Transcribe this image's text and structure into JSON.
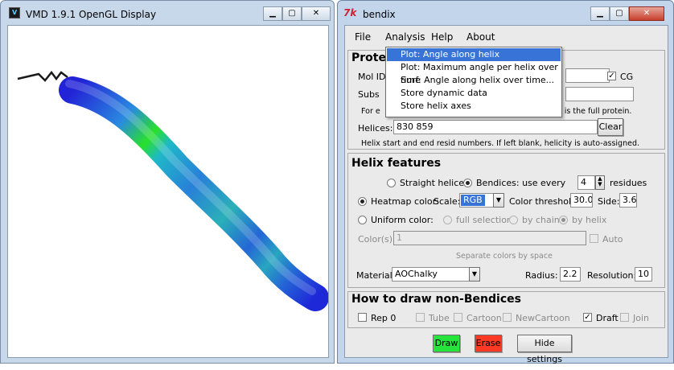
{
  "vmd": {
    "title": "VMD 1.9.1 OpenGL Display",
    "icon": "vmd-logo-icon",
    "window_buttons": [
      "minimize-icon",
      "maximize-icon",
      "close-icon"
    ]
  },
  "bendix": {
    "title": "bendix",
    "icon": "tk-feather-icon",
    "menu": {
      "file": "File",
      "analysis": "Analysis",
      "help": "Help",
      "about": "About"
    },
    "analysis_menu": [
      "Plot: Angle along helix",
      "Plot: Maximum angle per helix over time",
      "Surf: Angle along helix over time...",
      "Store dynamic data",
      "Store helix axes"
    ],
    "protein": {
      "title_visible": "Prote",
      "molid_label": "Mol ID",
      "cg_label": "CG",
      "cg_checked": true,
      "subset_label": "Subs",
      "subset_help_left": "For e",
      "subset_help_right": "t is the full protein.",
      "helices_label": "Helices:",
      "helices_value": "830 859",
      "clear_label": "Clear",
      "helix_help": "Helix start and end resid numbers. If left blank, helicity is auto-assigned."
    },
    "features": {
      "title": "Helix features",
      "straight_label": "Straight helices",
      "bendices_label": "Bendices: use every",
      "bendices_every": "4",
      "residues_label": "residues",
      "heatmap_label": "Heatmap color:",
      "scale_label": "Scale:",
      "scale_value": "RGB",
      "threshold_label": "Color threshold:",
      "threshold_value": "30.0",
      "side_label": "Side:",
      "side_value": "3.6",
      "uniform_label": "Uniform color:",
      "full_selection_label": "full selection",
      "by_chain_label": "by chain",
      "by_helix_label": "by helix",
      "colors_label": "Color(s):",
      "colors_value": "1",
      "auto_label": "Auto",
      "sep_help": "Separate colors by space",
      "material_label": "Material:",
      "material_value": "AOChalky",
      "radius_label": "Radius:",
      "radius_value": "2.2",
      "resolution_label": "Resolution:",
      "resolution_value": "10"
    },
    "nonbendices": {
      "title": "How to draw non-Bendices",
      "rep_label": "Rep 0",
      "tube_label": "Tube",
      "cartoon_label": "Cartoon",
      "newcartoon_label": "NewCartoon",
      "draft_label": "Draft",
      "draft_checked": true,
      "join_label": "Join"
    },
    "buttons": {
      "draw": "Draw",
      "erase": "Erase",
      "hide": "Hide settings"
    },
    "colors": {
      "draw_bg": "#27e43c",
      "erase_bg": "#ff3a24",
      "menu_highlight": "#3874d8"
    }
  }
}
